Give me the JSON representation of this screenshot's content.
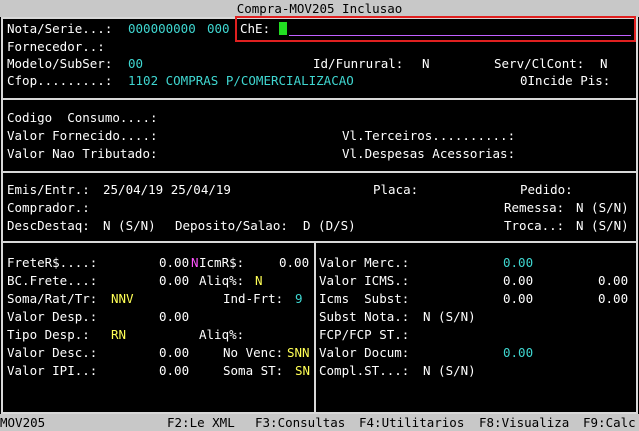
{
  "window": {
    "title": "Compra-MOV205  Inclusao"
  },
  "header": {
    "nota_label": "Nota/Serie...:",
    "nota_value": "000000000",
    "serie_value": "000",
    "che_label": "ChE:",
    "che_value": "",
    "fornecedor_label": "Fornecedor..:",
    "modelo_label": "Modelo/SubSer:",
    "modelo_value": "00",
    "funrural_label": "Id/Funrural:",
    "funrural_value": "N",
    "serv_label": "Serv/ClCont:",
    "serv_value": "N",
    "cfop_label": "Cfop.........:",
    "cfop_value": "1102 COMPRAS P/COMERCIALIZACAO",
    "incide_label": "0Incide Pis:"
  },
  "section2": {
    "codigo_label": "Codigo  Consumo....:",
    "valor_fornecido_label": "Valor Fornecido....:",
    "vl_terceiros_label": "Vl.Terceiros..........:",
    "valor_nao_tributado_label": "Valor Nao Tributado:",
    "vl_despesas_label": "Vl.Despesas Acessorias:"
  },
  "section3": {
    "emis_label": "Emis/Entr.:",
    "emis_value": "25/04/19 25/04/19",
    "placa_label": "Placa:",
    "pedido_label": "Pedido:",
    "comprador_label": "Comprador.:",
    "remessa_label": "Remessa:",
    "remessa_value": "N (S/N)",
    "descdestaq_label": "DescDestaq:",
    "descdestaq_value": "N (S/N)",
    "deposito_label": "Deposito/Salao:",
    "deposito_value": "D (D/S)",
    "troca_label": "Troca..:",
    "troca_value": "N (S/N)"
  },
  "left_panel": {
    "frete_label": "FreteR$....:",
    "frete_value": "0.00",
    "frete_flag": "N",
    "icmr_label": "IcmR$:",
    "icmr_value": "0.00",
    "bc_frete_label": "BC.Frete...:",
    "bc_frete_value": "0.00",
    "aliq_label": "Aliq%:",
    "aliq_value": "N",
    "soma_label": "Soma/Rat/Tr:",
    "soma_value": "NNV",
    "ind_frt_label": "Ind-Frt:",
    "ind_frt_value": "9",
    "valor_desp_label": "Valor Desp.:",
    "valor_desp_value": "0.00",
    "tipo_desp_label": "Tipo Desp.:",
    "tipo_desp_value": "RN",
    "aliq2_label": "Aliq%:",
    "valor_desc_label": "Valor Desc.:",
    "valor_desc_value": "0.00",
    "no_venc_label": "No Venc:",
    "no_venc_value": "SNN",
    "valor_ipi_label": "Valor IPI..:",
    "valor_ipi_value": "0.00",
    "soma_st_label": "Soma ST:",
    "soma_st_value": "SN"
  },
  "right_panel": {
    "valor_merc_label": "Valor Merc.:",
    "valor_merc_value": "0.00",
    "valor_icms_label": "Valor ICMS.:",
    "valor_icms_value": "0.00",
    "valor_icms_value2": "0.00",
    "icms_subst_label": "Icms  Subst:",
    "icms_subst_value": "0.00",
    "icms_subst_value2": "0.00",
    "subst_nota_label": "Subst Nota.:",
    "subst_nota_value": "N (S/N)",
    "fcp_label": "FCP/FCP ST.:",
    "valor_docum_label": "Valor Docum:",
    "valor_docum_value": "0.00",
    "compl_st_label": "Compl.ST...:",
    "compl_st_value": "N (S/N)"
  },
  "statusbar": {
    "program": "MOV205",
    "f2": "F2:Le XML",
    "f3": "F3:Consultas",
    "f4": "F4:Utilitarios",
    "f8": "F8:Visualiza",
    "f9": "F9:Calc"
  }
}
